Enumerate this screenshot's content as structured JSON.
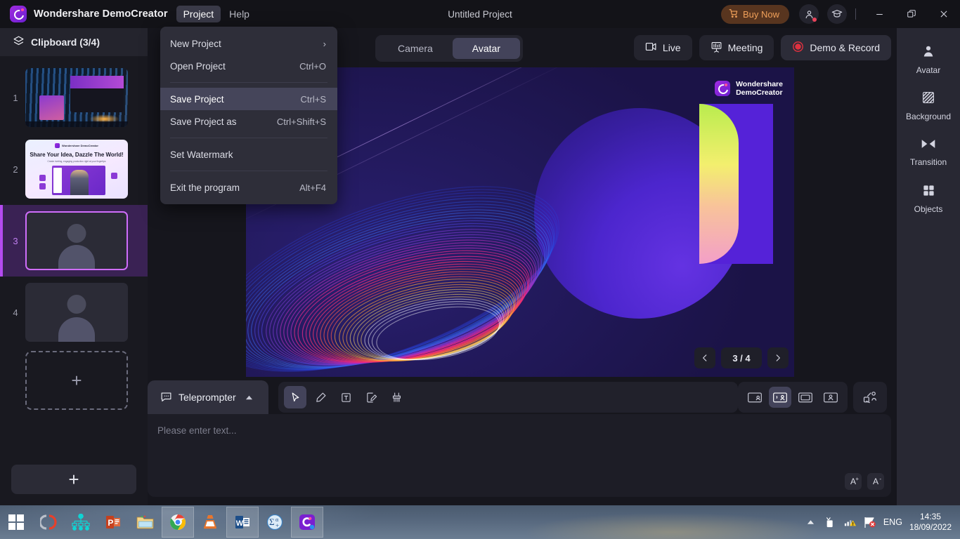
{
  "titlebar": {
    "brand": "Wondershare DemoCreator",
    "menus": [
      {
        "label": "Project",
        "active": true
      },
      {
        "label": "Help",
        "active": false
      }
    ],
    "project_title": "Untitled Project",
    "buy_now": "Buy Now",
    "account_icon": "account-icon",
    "academy_icon": "graduation-cap-icon",
    "minimize_icon": "minimize-icon",
    "restore_icon": "restore-icon",
    "close_icon": "close-icon"
  },
  "dropdown": {
    "items": [
      {
        "label": "New Project",
        "shortcut": "",
        "submenu": true,
        "highlight": false
      },
      {
        "label": "Open Project",
        "shortcut": "Ctrl+O",
        "submenu": false,
        "highlight": false
      },
      {
        "label": "Save Project",
        "shortcut": "Ctrl+S",
        "submenu": false,
        "highlight": true
      },
      {
        "label": "Save Project as",
        "shortcut": "Ctrl+Shift+S",
        "submenu": false,
        "highlight": false
      },
      {
        "label": "Set Watermark",
        "shortcut": "",
        "submenu": false,
        "highlight": false
      },
      {
        "label": "Exit the program",
        "shortcut": "Alt+F4",
        "submenu": false,
        "highlight": false
      }
    ]
  },
  "clipboard": {
    "title": "Clipboard (3/4)",
    "icon": "layers-icon",
    "slides": [
      {
        "number": "1",
        "kind": "desktop",
        "selected": false
      },
      {
        "number": "2",
        "kind": "promo",
        "selected": false
      },
      {
        "number": "3",
        "kind": "avatar",
        "selected": true
      },
      {
        "number": "4",
        "kind": "avatar",
        "selected": false
      }
    ],
    "add_slide_label": "+",
    "add_button_label": "+"
  },
  "toolbar": {
    "back_icon": "back-arrow-icon",
    "mode_tabs": [
      {
        "label": "Camera",
        "active": false
      },
      {
        "label": "Avatar",
        "active": true
      }
    ],
    "actions": [
      {
        "label": "Live",
        "icon": "live-video-icon"
      },
      {
        "label": "Meeting",
        "icon": "presentation-icon"
      },
      {
        "label": "Demo & Record",
        "icon": "record-circle-icon"
      }
    ]
  },
  "preview": {
    "watermark_line1": "Wondershare",
    "watermark_line2": "DemoCreator",
    "pager": {
      "prev_icon": "chevron-left-icon",
      "next_icon": "chevron-right-icon",
      "label": "3 / 4"
    }
  },
  "teleprompter": {
    "tab_label": "Teleprompter",
    "tab_icon": "speech-bubble-icon",
    "collapse_icon": "caret-up-icon",
    "placeholder": "Please enter text...",
    "tools": [
      {
        "name": "cursor-tool",
        "active": true
      },
      {
        "name": "pen-tool",
        "active": false
      },
      {
        "name": "text-tool",
        "active": false
      },
      {
        "name": "annotate-tool",
        "active": false
      },
      {
        "name": "eraser-tool",
        "active": false
      }
    ],
    "layouts": [
      {
        "name": "layout-screen-with-pip",
        "active": false
      },
      {
        "name": "layout-screen-with-avatar",
        "active": true
      },
      {
        "name": "layout-screen-only",
        "active": false
      },
      {
        "name": "layout-avatar-only",
        "active": false
      }
    ],
    "share_icon": "share-screen-icon",
    "font_increase": "A",
    "font_increase_sup": "+",
    "font_decrease": "A",
    "font_decrease_sup": "-"
  },
  "rail": {
    "items": [
      {
        "label": "Avatar",
        "icon": "person-icon"
      },
      {
        "label": "Background",
        "icon": "pattern-icon"
      },
      {
        "label": "Transition",
        "icon": "transition-icon"
      },
      {
        "label": "Objects",
        "icon": "grid-squares-icon"
      }
    ]
  },
  "taskbar": {
    "apps": [
      {
        "name": "windows-start-icon",
        "open": false
      },
      {
        "name": "cortana-icon",
        "open": false
      },
      {
        "name": "mindmap-icon",
        "open": false
      },
      {
        "name": "powerpoint-icon",
        "open": false
      },
      {
        "name": "file-explorer-icon",
        "open": false
      },
      {
        "name": "chrome-icon",
        "open": true
      },
      {
        "name": "vlc-icon",
        "open": false
      },
      {
        "name": "word-icon",
        "open": true
      },
      {
        "name": "mathtype-icon",
        "open": false
      },
      {
        "name": "democreator-icon",
        "open": true
      }
    ],
    "tray": {
      "show_hidden_icon": "caret-up-icon",
      "battery_icon": "battery-icon",
      "network_icon": "network-warning-icon",
      "action_center_icon": "action-center-error-icon",
      "language": "ENG",
      "time": "14:35",
      "date": "18/09/2022"
    }
  },
  "colors": {
    "accent_purple": "#b44bf0",
    "buy_now": "#f0a05a",
    "record_red": "#e0313f",
    "panel_bg": "#191920",
    "app_bg": "#16161d"
  }
}
